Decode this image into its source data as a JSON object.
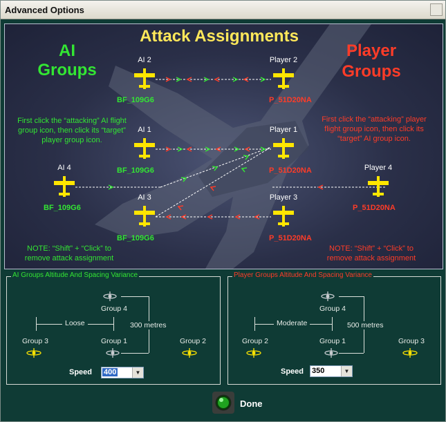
{
  "window": {
    "title": "Advanced Options"
  },
  "map": {
    "title": "Attack Assignments",
    "ai_heading_line1": "AI",
    "ai_heading_line2": "Groups",
    "player_heading_line1": "Player",
    "player_heading_line2": "Groups",
    "ai_instruction": "First click the “attacking” AI flight group icon, then click its “target” player group icon.",
    "player_instruction": "First click the “attacking” player flight group icon, then click its “target” AI group icon.",
    "ai_note": "NOTE: “Shift” + “Click” to remove attack assignment",
    "player_note": "NOTE: “Shift” + “Click” to remove attack assignment",
    "ai_groups": [
      {
        "label": "AI 2",
        "type": "BF_109G6"
      },
      {
        "label": "AI 1",
        "type": "BF_109G6"
      },
      {
        "label": "AI 4",
        "type": "BF_109G6"
      },
      {
        "label": "AI 3",
        "type": "BF_109G6"
      }
    ],
    "player_groups": [
      {
        "label": "Player 2",
        "type": "P_51D20NA"
      },
      {
        "label": "Player 1",
        "type": "P_51D20NA"
      },
      {
        "label": "Player 4",
        "type": "P_51D20NA"
      },
      {
        "label": "Player 3",
        "type": "P_51D20NA"
      }
    ]
  },
  "ai_panel": {
    "legend": "AI Groups Altitude And Spacing Variance",
    "group_top": "Group 4",
    "group_left": "Group 3",
    "group_mid": "Group 1",
    "group_right": "Group 2",
    "spacing": "Loose",
    "altitude": "300 metres",
    "speed_label": "Speed",
    "speed_value": "400"
  },
  "player_panel": {
    "legend": "Player Groups Altitude And Spacing Variance",
    "group_top": "Group 4",
    "group_left": "Group 2",
    "group_mid": "Group 1",
    "group_right": "Group 3",
    "spacing": "Moderate",
    "altitude": "500 metres",
    "speed_label": "Speed",
    "speed_value": "350"
  },
  "footer": {
    "done_label": "Done"
  },
  "colors": {
    "ai_green": "#33e633",
    "player_red": "#ff3c28",
    "title_yellow": "#ffe85a",
    "plane_yellow": "#ffe600"
  }
}
